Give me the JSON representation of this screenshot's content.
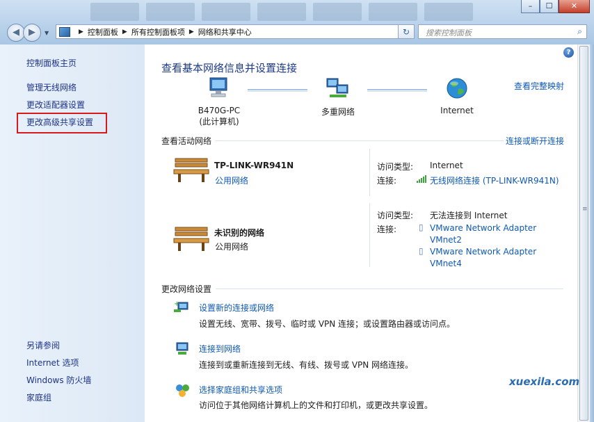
{
  "window": {
    "buttons": {
      "minimize": "–",
      "maximize": "☐",
      "close": "✕"
    }
  },
  "addressbar": {
    "crumbs": [
      "控制面板",
      "所有控制面板项",
      "网络和共享中心"
    ],
    "search_placeholder": "搜索控制面板"
  },
  "sidebar": {
    "home": "控制面板主页",
    "items": [
      "管理无线网络",
      "更改适配器设置",
      "更改高级共享设置"
    ],
    "see_also_title": "另请参阅",
    "see_also": [
      "Internet 选项",
      "Windows 防火墙",
      "家庭组"
    ]
  },
  "main": {
    "help": "?",
    "title": "查看基本网络信息并设置连接",
    "view_full_map": "查看完整映射",
    "map": {
      "computer": {
        "name": "B470G-PC",
        "sub": "(此计算机)"
      },
      "middle": "多重网络",
      "internet": "Internet"
    },
    "active_networks": {
      "title": "查看活动网络",
      "connect_link": "连接或断开连接",
      "networks": [
        {
          "name": "TP-LINK-WR941N",
          "type_link": "公用网络",
          "access_label": "访问类型:",
          "access_value": "Internet",
          "conn_label": "连接:",
          "connections": [
            "无线网络连接 (TP-LINK-WR941N)"
          ]
        },
        {
          "name": "未识别的网络",
          "type_link": "公用网络",
          "access_label": "访问类型:",
          "access_value": "无法连接到 Internet",
          "conn_label": "连接:",
          "connections": [
            "VMware Network Adapter",
            "VMnet2",
            "VMware Network Adapter",
            "VMnet4"
          ]
        }
      ]
    },
    "change_settings": {
      "title": "更改网络设置",
      "items": [
        {
          "link": "设置新的连接或网络",
          "desc": "设置无线、宽带、拨号、临时或 VPN 连接；或设置路由器或访问点。"
        },
        {
          "link": "连接到网络",
          "desc": "连接到或重新连接到无线、有线、拨号或 VPN 网络连接。"
        },
        {
          "link": "选择家庭组和共享选项",
          "desc": "访问位于其他网络计算机上的文件和打印机，或更改共享设置。"
        }
      ]
    }
  },
  "watermark": "xuexila.com",
  "colors": {
    "link": "#0f59b6",
    "title": "#1d3a8a",
    "highlight_box": "#d7191c",
    "sidebar_bg": "#dce8f5"
  }
}
